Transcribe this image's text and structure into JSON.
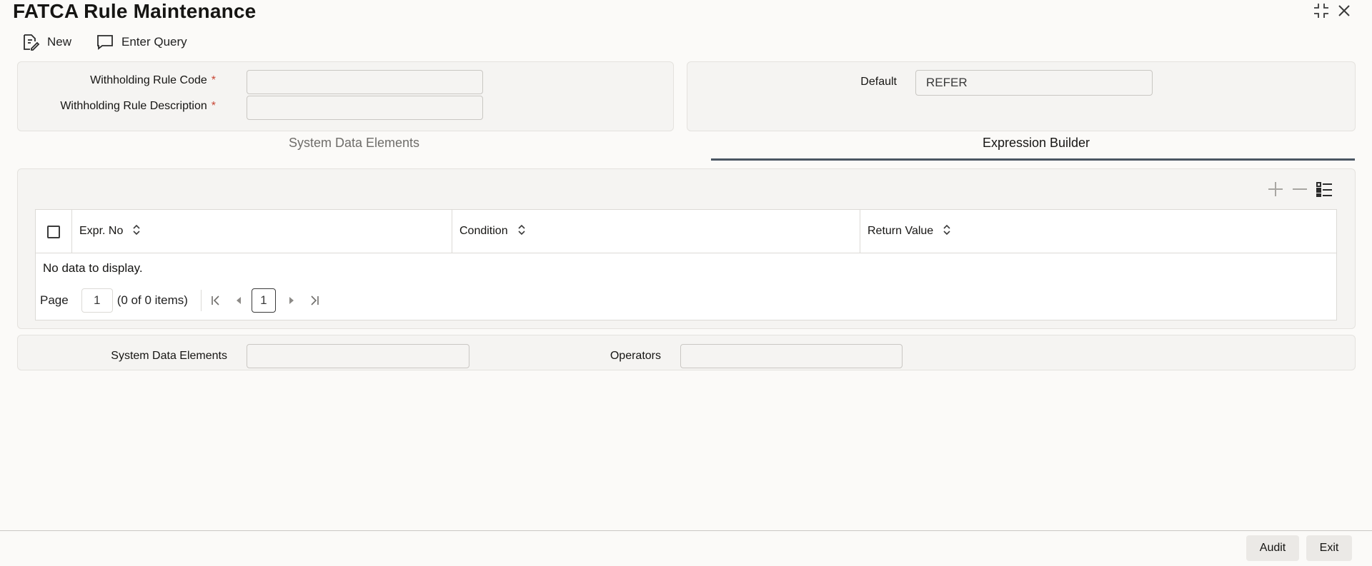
{
  "window": {
    "title": "FATCA Rule Maintenance"
  },
  "toolbar": {
    "new_label": "New",
    "enter_query_label": "Enter Query"
  },
  "form": {
    "rule_code_label": "Withholding Rule Code",
    "rule_desc_label": "Withholding Rule Description",
    "rule_code_value": "",
    "rule_desc_value": "",
    "required_mark": "*",
    "default_label": "Default",
    "default_value": "REFER"
  },
  "tabs": [
    {
      "label": "System Data Elements",
      "active": false
    },
    {
      "label": "Expression Builder",
      "active": true
    }
  ],
  "grid": {
    "columns": [
      "Expr. No",
      "Condition",
      "Return Value"
    ],
    "empty_text": "No data to display.",
    "page_label": "Page",
    "page_value": "1",
    "items_text": "(0 of 0 items)",
    "current_page": "1"
  },
  "bottom": {
    "sde_label": "System Data Elements",
    "sde_value": "",
    "operators_label": "Operators",
    "operators_value": ""
  },
  "footer": {
    "audit_label": "Audit",
    "exit_label": "Exit"
  },
  "colors": {
    "accent_tab": "#4b5663",
    "required": "#c74634"
  }
}
